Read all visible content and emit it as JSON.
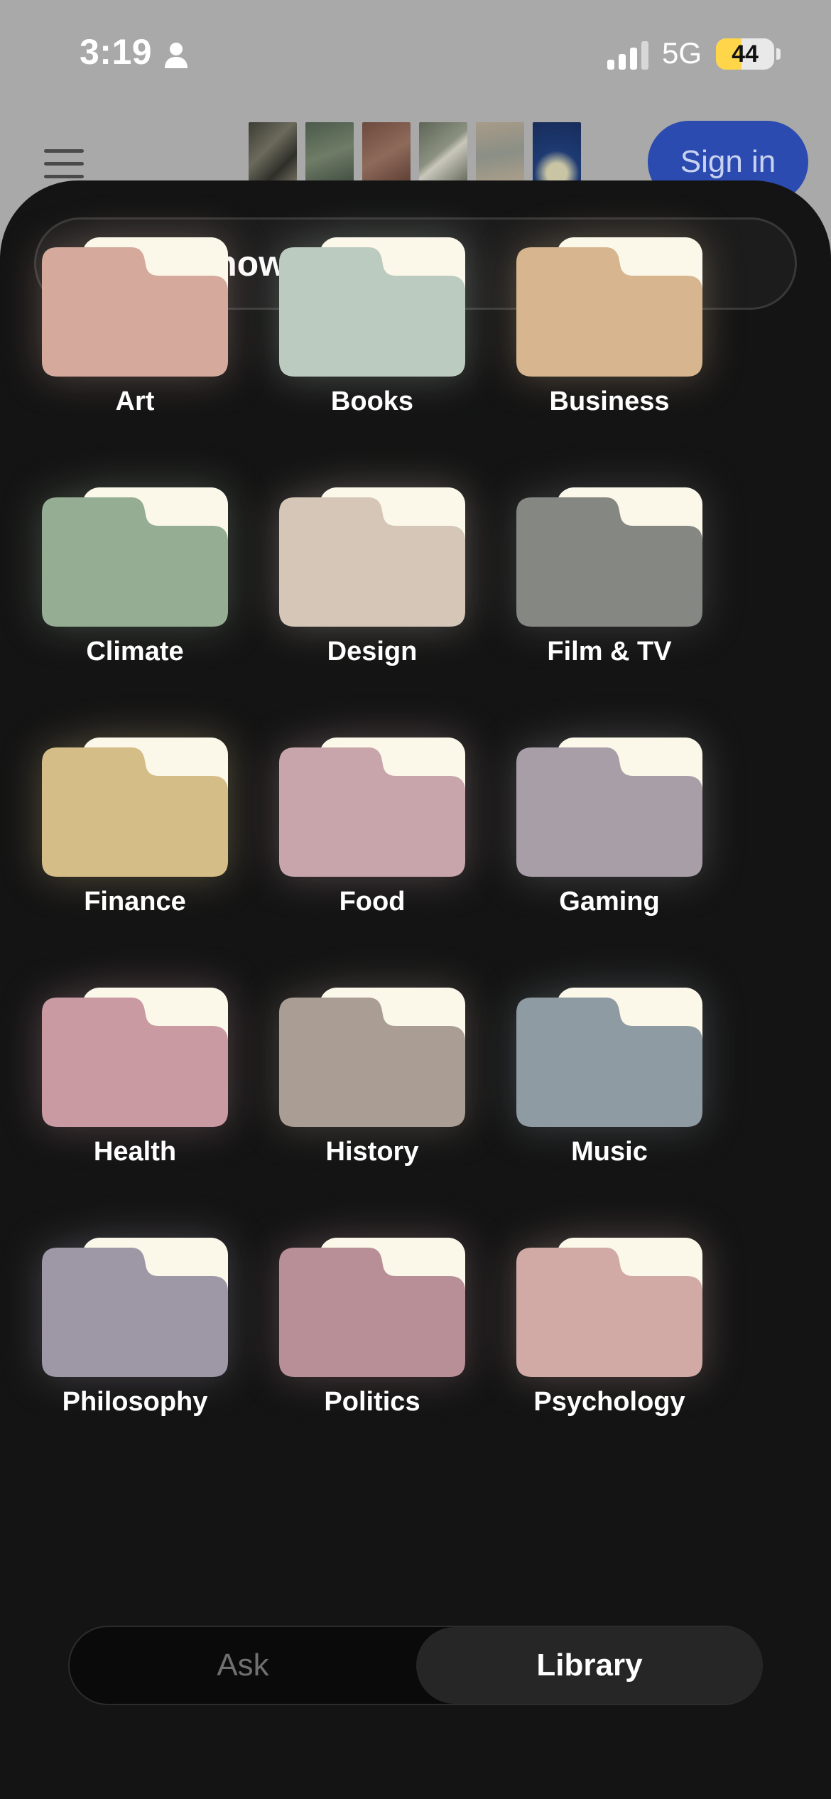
{
  "status_bar": {
    "time": "3:19",
    "network": "5G",
    "battery_level": "44",
    "battery_fraction": 0.44
  },
  "background": {
    "signin_label": "Sign in"
  },
  "sheet": {
    "title": "Knowledge",
    "title_icon": "folder-icon"
  },
  "folders": [
    {
      "label": "Art",
      "color": "#d5aa9c"
    },
    {
      "label": "Books",
      "color": "#bccbbf"
    },
    {
      "label": "Business",
      "color": "#d7b68f"
    },
    {
      "label": "Climate",
      "color": "#95ad92"
    },
    {
      "label": "Design",
      "color": "#d6c6b8"
    },
    {
      "label": "Film & TV",
      "color": "#858783"
    },
    {
      "label": "Finance",
      "color": "#d5bd87"
    },
    {
      "label": "Food",
      "color": "#c8a5ab"
    },
    {
      "label": "Gaming",
      "color": "#a89ea7"
    },
    {
      "label": "Health",
      "color": "#c99aa2"
    },
    {
      "label": "History",
      "color": "#aa9e94"
    },
    {
      "label": "Music",
      "color": "#8f9ba3"
    },
    {
      "label": "Philosophy",
      "color": "#9e97a6"
    },
    {
      "label": "Politics",
      "color": "#b88e97"
    },
    {
      "label": "Psychology",
      "color": "#d1aaa6"
    }
  ],
  "tabs": {
    "ask": "Ask",
    "library": "Library",
    "selected": "Library"
  }
}
